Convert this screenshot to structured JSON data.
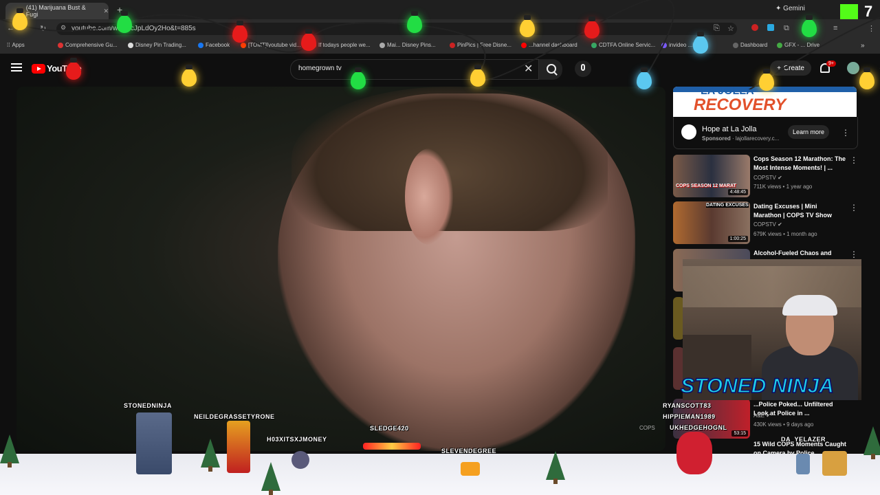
{
  "browser": {
    "tab_title": "(41) Marijuana Bust & Fugi",
    "new_tab": "+",
    "gemini": "Gemini",
    "url": "youtube.com/w...=ccJpLdOy2Ho&t=885s",
    "bookmarks": [
      "Apps",
      "Comprehensive Gu...",
      "Disney Pin Trading...",
      "Facebook",
      "[TOMT][youtube vid...",
      "If todays people we...",
      "Mai... Disney Pins...",
      "PinPics | Free Disne...",
      "...hannel dashboard",
      "CDTFA Online Servic...",
      "invideo ...id...",
      "Dashboard",
      "GFX - ... Drive"
    ]
  },
  "youtube": {
    "logo_text": "YouTube",
    "search_query": "homegrown tv",
    "create_label": "Create",
    "notif_badge": "9+"
  },
  "ad": {
    "banner_line1": "LA JOLLA",
    "banner_line2": "RECOVERY",
    "name": "Hope at La Jolla",
    "sponsored": "Sponsored",
    "domain": "lajollarecovery.c...",
    "cta": "Learn more"
  },
  "recommendations": [
    {
      "title": "Cops Season 12 Marathon: The Most Intense Moments! | ...",
      "channel": "COPSTV",
      "meta": "711K views • 1 year ago",
      "duration": "4:48:45",
      "thumb_text": "COPS SEASON 12 MARAT"
    },
    {
      "title": "Dating Excuses | Mini Marathon | COPS TV Show",
      "channel": "COPSTV",
      "meta": "679K views • 1 month ago",
      "duration": "1:00:25",
      "thumb_text": "DATING EXCUSES"
    },
    {
      "title": "Alcohol-Fueled Chaos and"
    },
    {
      "title": "...Police Poked... Unfiltered Look at Police in ...",
      "channel": "A&E",
      "meta": "430K views • 9 days ago",
      "duration": "53:15"
    },
    {
      "title": "15 Wild COPS Moments Caught on Camera by Police ..."
    }
  ],
  "overlay": {
    "streamer_name": "STONED NINJA",
    "kick_number": "7",
    "chatters": [
      "STONEDNINJA",
      "NEILDEGRASSETYRONE",
      "H03XITSXJMONEY",
      "SLEDGE420",
      "SLEVENDEGREE",
      "RYANSCOTT83",
      "HIPPIEMAN1989",
      "UKHEDGEHOGNL",
      "DA_YELAZER"
    ],
    "video_watermark": "COPS"
  },
  "colors": {
    "youtube_red": "#ff0000",
    "bulb_colors": [
      "#ffcf33",
      "#22dd44",
      "#e61b1b",
      "#5bc8f0"
    ],
    "ninja_text": "#1fd0e8",
    "kick_green": "#53fc18"
  }
}
